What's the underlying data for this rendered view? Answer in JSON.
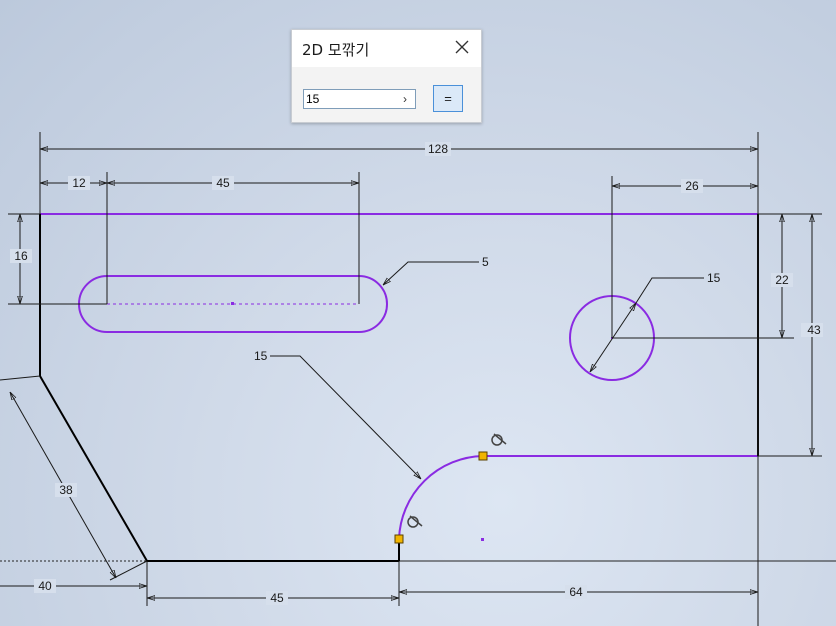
{
  "dialog": {
    "title": "2D 모깎기",
    "input_value": "15",
    "arrow_label": "›",
    "apply_label": "="
  },
  "dimensions": {
    "overall_width": "128",
    "left_offset": "12",
    "slot_length": "45",
    "circle_offset": "26",
    "slot_height": "16",
    "circle_height": "22",
    "overall_height": "43",
    "slot_radius": "5",
    "circle_diameter": "15",
    "fillet_radius": "15",
    "chamfer_length": "38",
    "bottom_left": "40",
    "bottom_mid": "45",
    "bottom_right": "64"
  },
  "colors": {
    "sketch_line": "#8a2be2",
    "fixed_line": "#000000",
    "dimension_line": "#1a1a1a",
    "point_marker": "#f0b400"
  }
}
